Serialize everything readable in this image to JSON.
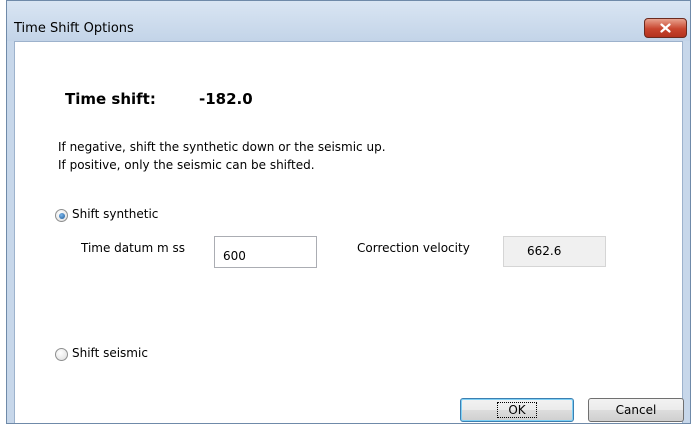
{
  "window": {
    "title": "Time Shift Options"
  },
  "time_shift": {
    "label": "Time shift:",
    "value": "-182.0"
  },
  "notes": {
    "line1": "If negative, shift  the synthetic down or the seismic up.",
    "line2": "If positive, only the seismic can be shifted."
  },
  "options": {
    "shift_synthetic_label": "Shift synthetic",
    "shift_synthetic_selected": true,
    "shift_seismic_label": "Shift seismic",
    "shift_seismic_selected": false
  },
  "synthetic_params": {
    "time_datum_label": "Time datum m ss",
    "time_datum_value": "600",
    "correction_velocity_label": "Correction velocity",
    "correction_velocity_value": "662.6"
  },
  "buttons": {
    "ok_label": "OK",
    "cancel_label": "Cancel"
  },
  "icons": {
    "close": "close-icon"
  },
  "colors": {
    "titlebar": "#c7d7ea",
    "close_button": "#c8452e",
    "radio_selected": "#1c5896",
    "readonly_field": "#f0f0f0"
  }
}
